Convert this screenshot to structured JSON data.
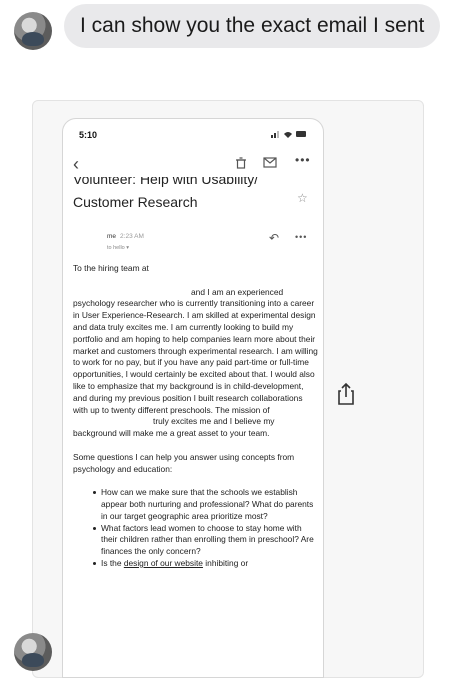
{
  "thread": {
    "message_text": "I can show you the exact email I sent"
  },
  "email": {
    "status_time": "5:10",
    "subject_line1": "Volunteer: Help with Usability/",
    "subject_line2": "Customer Research",
    "sender": "me",
    "sent_time": "2:23 AM",
    "recipient": "to hello",
    "greeting": "To the hiring team at",
    "paragraph1_intro": "and I am an experienced psychology researcher who is currently transitioning into a career in User Experience-Research. I am skilled at experimental design and data truly excites me. I am currently looking to build my portfolio and am hoping to help companies learn more about their market and customers through experimental research. I am willing to work for no pay, but if you have any paid part-time or full-time opportunities, I would certainly be excited about that. I would also like to emphasize that my background is in child-development, and during my previous position I built research collaborations with up to twenty different preschools. The mission of",
    "paragraph1_end": "truly excites me and I believe my background will make me a great asset to your team.",
    "paragraph2": "Some questions I can help you answer using concepts from psychology and education:",
    "bullets": [
      "How can we make sure that the schools we establish appear both nurturing and professional? What do parents in our target geographic area prioritize most?",
      "What factors lead women to choose to stay home with their children rather than enrolling them in preschool? Are finances the only concern?"
    ],
    "bullet3_start": "Is the ",
    "bullet3_link": "design of our website",
    "bullet3_end": " inhibiting or"
  }
}
